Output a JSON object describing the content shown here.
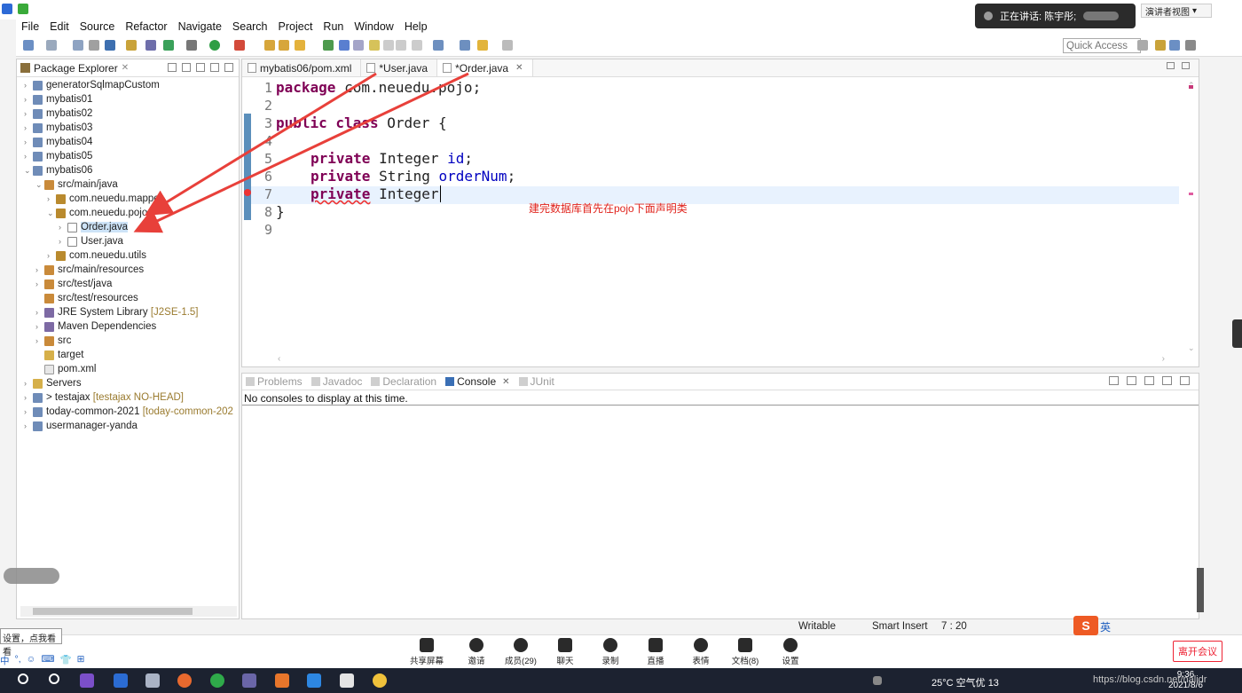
{
  "meeting_top": {
    "speaker_text": "正在讲话: 陈宇彤;",
    "presenter_view": "演讲者视图"
  },
  "menu": [
    "File",
    "Edit",
    "Source",
    "Refactor",
    "Navigate",
    "Search",
    "Project",
    "Run",
    "Window",
    "Help"
  ],
  "toolbar": {
    "quick_access": "Quick Access"
  },
  "explorer": {
    "title": "Package Explorer",
    "items": [
      {
        "label": "generatorSqlmapCustom",
        "deco": ""
      },
      {
        "label": "mybatis01",
        "deco": ""
      },
      {
        "label": "mybatis02",
        "deco": ""
      },
      {
        "label": "mybatis03",
        "deco": ""
      },
      {
        "label": "mybatis04",
        "deco": ""
      },
      {
        "label": "mybatis05",
        "deco": ""
      },
      {
        "label": "mybatis06",
        "deco": ""
      },
      {
        "label": "src/main/java",
        "deco": ""
      },
      {
        "label": "com.neuedu.mapper",
        "deco": ""
      },
      {
        "label": "com.neuedu.pojo",
        "deco": ""
      },
      {
        "label": "Order.java",
        "deco": ""
      },
      {
        "label": "User.java",
        "deco": ""
      },
      {
        "label": "com.neuedu.utils",
        "deco": ""
      },
      {
        "label": "src/main/resources",
        "deco": ""
      },
      {
        "label": "src/test/java",
        "deco": ""
      },
      {
        "label": "src/test/resources",
        "deco": ""
      },
      {
        "label": "JRE System Library",
        "deco": "[J2SE-1.5]"
      },
      {
        "label": "Maven Dependencies",
        "deco": ""
      },
      {
        "label": "src",
        "deco": ""
      },
      {
        "label": "target",
        "deco": ""
      },
      {
        "label": "pom.xml",
        "deco": ""
      },
      {
        "label": "Servers",
        "deco": ""
      },
      {
        "label": "> testajax",
        "deco": "[testajax NO-HEAD]"
      },
      {
        "label": "today-common-2021",
        "deco": "[today-common-202"
      },
      {
        "label": "usermanager-yanda",
        "deco": ""
      }
    ]
  },
  "editor": {
    "tabs": [
      "mybatis06/pom.xml",
      "*User.java",
      "*Order.java"
    ],
    "lines": [
      "1",
      "2",
      "3",
      "4",
      "5",
      "6",
      "7",
      "8",
      "9"
    ],
    "code": {
      "l1_kw": "package",
      "l1_rest": " com.neuedu.pojo;",
      "l3_kw": "public class",
      "l3_rest": " Order {",
      "l5_kw": "private",
      "l5_type": " Integer ",
      "l5_field": "id",
      "l5_end": ";",
      "l6_kw": "private",
      "l6_type": " String ",
      "l6_field": "orderNum",
      "l6_end": ";",
      "l7_kw": "private",
      "l7_type": " Integer",
      "l8": "}"
    },
    "annotation": "建完数据库首先在pojo下面声明类"
  },
  "console": {
    "tabs": [
      "Problems",
      "Javadoc",
      "Declaration",
      "Console",
      "JUnit"
    ],
    "message": "No consoles to display at this time."
  },
  "status": {
    "writable": "Writable",
    "insert_mode": "Smart Insert",
    "position": "7 : 20"
  },
  "meeting_bar": {
    "buttons": [
      "共享屏幕",
      "邀请",
      "成员(29)",
      "聊天",
      "录制",
      "直播",
      "表情",
      "文档(8)",
      "设置"
    ],
    "leave": "离开会议",
    "tooltip": "设置，点我看看"
  },
  "ime": {
    "sogou": "S",
    "sogou_mode": "英",
    "bar": [
      "中",
      "°,",
      "☺",
      "⌨",
      "👕",
      "⊞"
    ]
  },
  "taskbar": {
    "weather": "25°C 空气优 13",
    "time": "9:36",
    "date": "2021/8/6",
    "watermark": "https://blog.csdn.net/nalidr"
  },
  "colors": {
    "keyword": "#7f0055",
    "field": "#0000c0",
    "annotation": "#e0241d",
    "arrow": "#e8403a"
  }
}
